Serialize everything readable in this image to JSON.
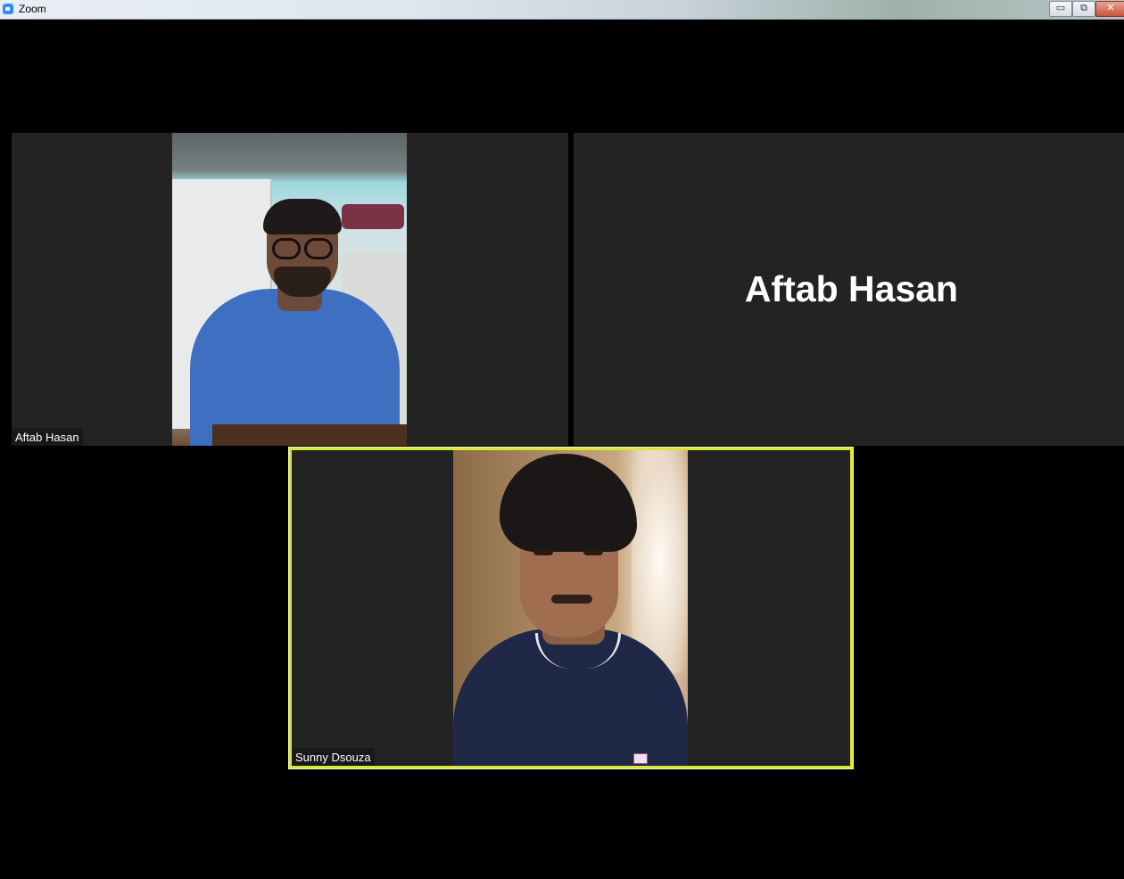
{
  "window": {
    "title": "Zoom",
    "controls": {
      "minimize": "▭",
      "maximize": "⧉",
      "close": "✕"
    }
  },
  "participants": [
    {
      "name": "Aftab Hasan",
      "video_on": true,
      "role": "speaker-view-tile"
    },
    {
      "name": "Aftab Hasan",
      "video_on": false,
      "display_name_large": "Aftab Hasan"
    },
    {
      "name": "Sunny Dsouza",
      "video_on": true,
      "active_speaker": true
    }
  ],
  "colors": {
    "background": "#000000",
    "tile_background": "#232323",
    "active_speaker_border": "#d9e63b",
    "name_label_bg": "#181818",
    "text": "#ffffff"
  },
  "icons": {
    "app": "zoom-logo-icon",
    "minimize": "minimize-icon",
    "maximize": "restore-icon",
    "close": "close-icon"
  }
}
